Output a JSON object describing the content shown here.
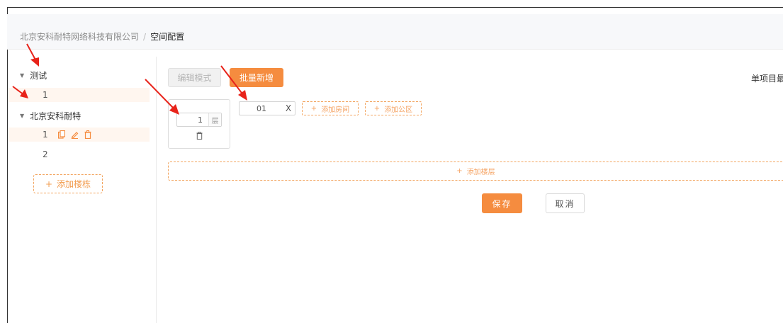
{
  "breadcrumb": {
    "parent": "北京安科耐特网络科技有限公司",
    "separator": "/",
    "current": "空间配置"
  },
  "sidebar": {
    "buildings": [
      {
        "label": "测试",
        "children": [
          {
            "label": "1",
            "selected": true
          }
        ]
      },
      {
        "label": "北京安科耐特",
        "children": [
          {
            "label": "1",
            "selected": true,
            "actions": [
              "copy-icon",
              "edit-icon",
              "delete-icon"
            ]
          },
          {
            "label": "2",
            "selected": false
          }
        ]
      }
    ],
    "add_building_label": "添加楼栋"
  },
  "toolbar": {
    "edit_mode_label": "编辑模式",
    "batch_add_label": "批量新增",
    "single_item_label": "单项目最"
  },
  "floor": {
    "value": "1",
    "unit": "层"
  },
  "room": {
    "value": "01",
    "remove_glyph": "X",
    "add_room_label": "添加房间",
    "add_public_label": "添加公区"
  },
  "add_floor_label": "添加楼层",
  "actions": {
    "save_label": "保存",
    "cancel_label": "取消"
  },
  "colors": {
    "accent": "#f58c3f",
    "accent_dashed": "#f2a45e",
    "selected_bg": "#fff6ef",
    "annotation_arrow": "#e8231a"
  }
}
